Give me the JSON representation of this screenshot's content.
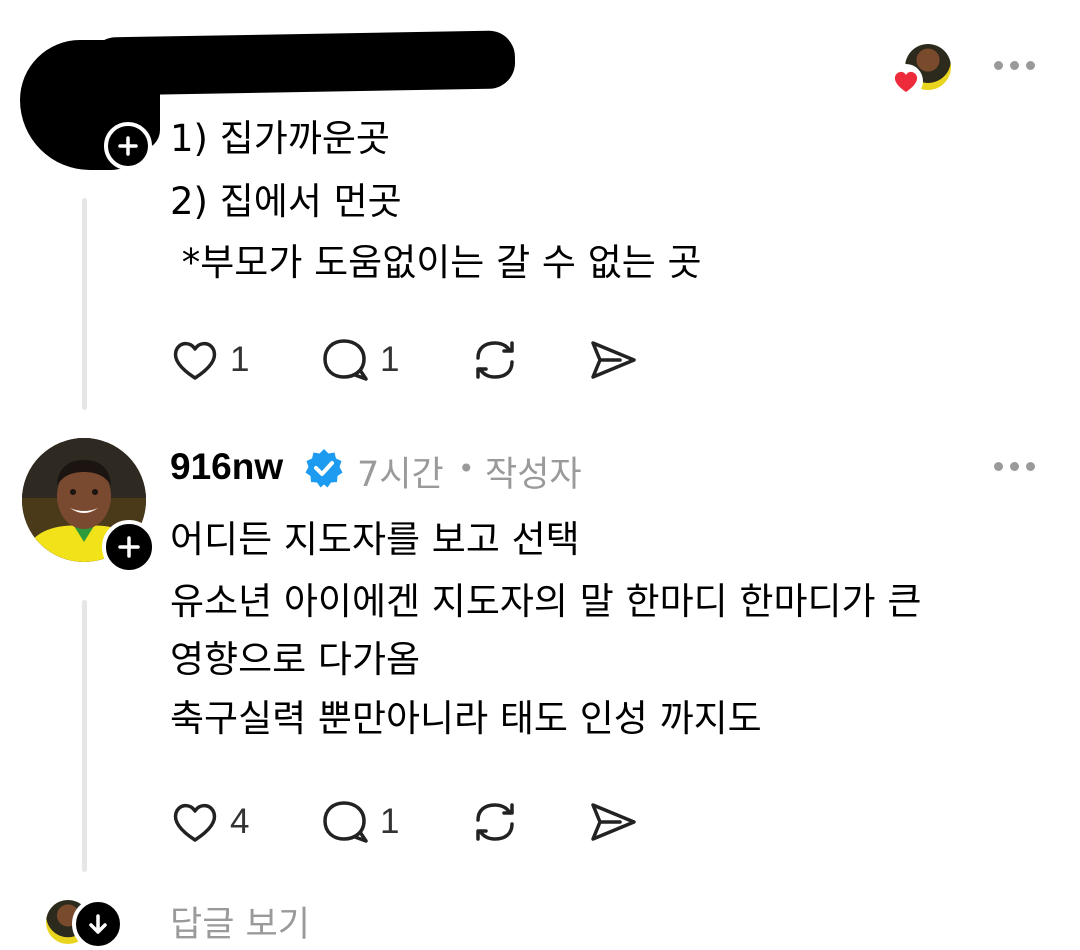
{
  "post1": {
    "lines": [
      "1) 집가까운곳",
      "2) 집에서 먼곳",
      " *부모가 도움없이는 갈 수 없는 곳"
    ],
    "like_count": "1",
    "reply_count": "1"
  },
  "post2": {
    "username": "916nw",
    "time": "7시간",
    "separator": "•",
    "author_label": "작성자",
    "lines": [
      "어디든 지도자를 보고 선택",
      "유소년 아이에겐 지도자의 말 한마디 한마디가 큰",
      "영향으로 다가옴",
      "축구실력 뿐만아니라 태도 인성 까지도"
    ],
    "like_count": "4",
    "reply_count": "1"
  },
  "footer": {
    "view_replies": "답글 보기"
  },
  "colors": {
    "verified": "#1d9bf0",
    "heart": "#ee2b3b",
    "muted": "#9a9a9a",
    "thread_line": "#e6e6e6"
  }
}
